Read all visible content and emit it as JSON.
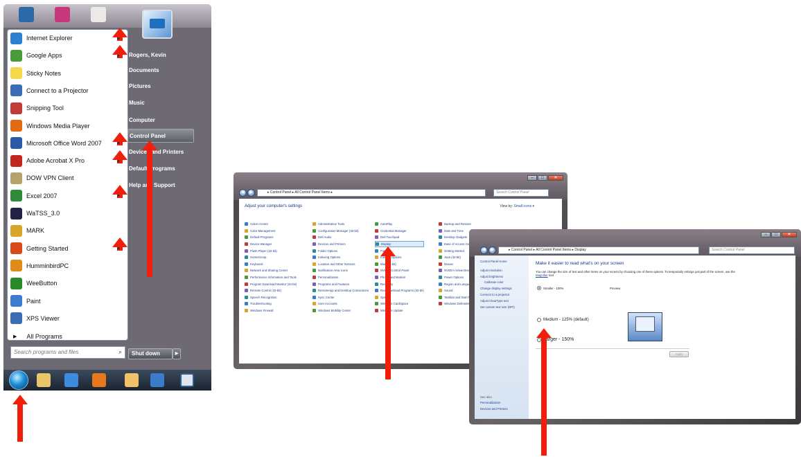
{
  "start_menu": {
    "programs": [
      {
        "label": "Internet Explorer",
        "icon": "internet-explorer-icon",
        "submenu": true,
        "color": "#2c7fd1"
      },
      {
        "label": "Google Apps",
        "icon": "google-apps-icon",
        "submenu": true,
        "color": "#4a9a3a"
      },
      {
        "label": "Sticky Notes",
        "icon": "sticky-notes-icon",
        "submenu": false,
        "color": "#f3d94a"
      },
      {
        "label": "Connect to a Projector",
        "icon": "projector-icon",
        "submenu": false,
        "color": "#3a6db3"
      },
      {
        "label": "Snipping Tool",
        "icon": "snipping-tool-icon",
        "submenu": false,
        "color": "#c23b3b"
      },
      {
        "label": "Windows Media Player",
        "icon": "media-player-icon",
        "submenu": false,
        "color": "#e26b12"
      },
      {
        "label": "Microsoft Office Word 2007",
        "icon": "word-icon",
        "submenu": true,
        "color": "#2b5aa8"
      },
      {
        "label": "Adobe Acrobat X Pro",
        "icon": "acrobat-icon",
        "submenu": true,
        "color": "#c4261d"
      },
      {
        "label": "DOW VPN Client",
        "icon": "vpn-client-icon",
        "submenu": false,
        "color": "#b5a16a"
      },
      {
        "label": "Excel 2007",
        "icon": "excel-icon",
        "submenu": true,
        "color": "#2f8a3a"
      },
      {
        "label": "WaTSS_3.0",
        "icon": "watss-icon",
        "submenu": false,
        "color": "#224"
      },
      {
        "label": "MARK",
        "icon": "mark-icon",
        "submenu": false,
        "color": "#d6a62a"
      },
      {
        "label": "Getting Started",
        "icon": "getting-started-icon",
        "submenu": true,
        "color": "#d84a1a"
      },
      {
        "label": "HumminbirdPC",
        "icon": "humminbird-icon",
        "submenu": false,
        "color": "#e08a1a"
      },
      {
        "label": "WeeButton",
        "icon": "weebutton-icon",
        "submenu": false,
        "color": "#2a8a2a"
      },
      {
        "label": "Paint",
        "icon": "paint-icon",
        "submenu": false,
        "color": "#3d7bd1"
      },
      {
        "label": "XPS Viewer",
        "icon": "xps-viewer-icon",
        "submenu": false,
        "color": "#3a6db3"
      }
    ],
    "all_programs": "All Programs",
    "search_placeholder": "Search programs and files",
    "right_items": [
      "Rogers, Kevin",
      "Documents",
      "Pictures",
      "Music",
      "Computer",
      "Control Panel",
      "Devices and Printers",
      "Default Programs",
      "Help and Support"
    ],
    "highlighted_right": "Control Panel",
    "shutdown": "Shut down"
  },
  "control_panel": {
    "address": "▸ Control Panel ▸ All Control Panel Items ▸",
    "search_placeholder": "Search Control Panel",
    "heading": "Adjust your computer's settings",
    "view_by_label": "View by:",
    "view_by_value": "Small icons ▾",
    "columns": [
      [
        "Action Center",
        "Color Management",
        "Default Programs",
        "Device Manager",
        "Flash Player (32-bit)",
        "HomeGroup",
        "Keyboard",
        "Network and Sharing Center",
        "Performance Information and Tools",
        "Program Download Monitor (32-bit)",
        "Remote Control (32-bit)",
        "Speech Recognition",
        "Troubleshooting",
        "Windows Firewall"
      ],
      [
        "Administrative Tools",
        "Configuration Manager (32-bit)",
        "Dell Audio",
        "Devices and Printers",
        "Folder Options",
        "Indexing Options",
        "Location and Other Sensors",
        "Notification Area Icons",
        "Personalization",
        "Programs and Features",
        "RemoteApp and Desktop Connections",
        "Sync Center",
        "User Accounts",
        "Windows Mobility Center"
      ],
      [
        "AutoPlay",
        "Credential Manager",
        "Dell Touchpad",
        "Display",
        "Fonts",
        "Internet Options",
        "Mail (32-bit)",
        "NVIDIA Control Panel",
        "Phone and Modem",
        "Recovery",
        "Run Download Programs (32-bit)",
        "System",
        "Windows CardSpace",
        "Windows Update"
      ],
      [
        "Backup and Restore",
        "Date and Time",
        "Desktop Gadgets",
        "Ease of Access Center",
        "Getting Started",
        "Java (32-bit)",
        "Mouse",
        "NVIDIA nView Desktop",
        "Power Options",
        "Region and Language",
        "Sound",
        "Taskbar and Start Menu",
        "Windows Defender"
      ]
    ],
    "highlighted_item": "Display"
  },
  "display_window": {
    "address": "▸ Control Panel ▸ All Control Panel Items ▸ Display",
    "search_placeholder": "Search Control Panel",
    "sidebar_items": [
      "Control Panel Home",
      "Adjust resolution",
      "Adjust brightness",
      "Calibrate color",
      "Change display settings",
      "Connect to a projector",
      "Adjust ClearType text",
      "Set custom text size (DPI)"
    ],
    "see_also_label": "See also",
    "see_also_items": [
      "Personalization",
      "Devices and Printers"
    ],
    "title": "Make it easier to read what's on your screen",
    "description_before": "You can change the size of text and other items on your screen by choosing one of these options. To temporarily enlarge just part of the screen, use the ",
    "description_link": "Magnifier",
    "description_after": " tool.",
    "options": [
      "Smaller - 100%",
      "Medium - 125% (default)",
      "Larger - 150%"
    ],
    "selected_option": "Smaller - 100%",
    "preview_label": "Preview",
    "apply": "Apply"
  },
  "colors": {
    "arrow": "#f01e0a",
    "link_blue": "#1e3f8a"
  }
}
